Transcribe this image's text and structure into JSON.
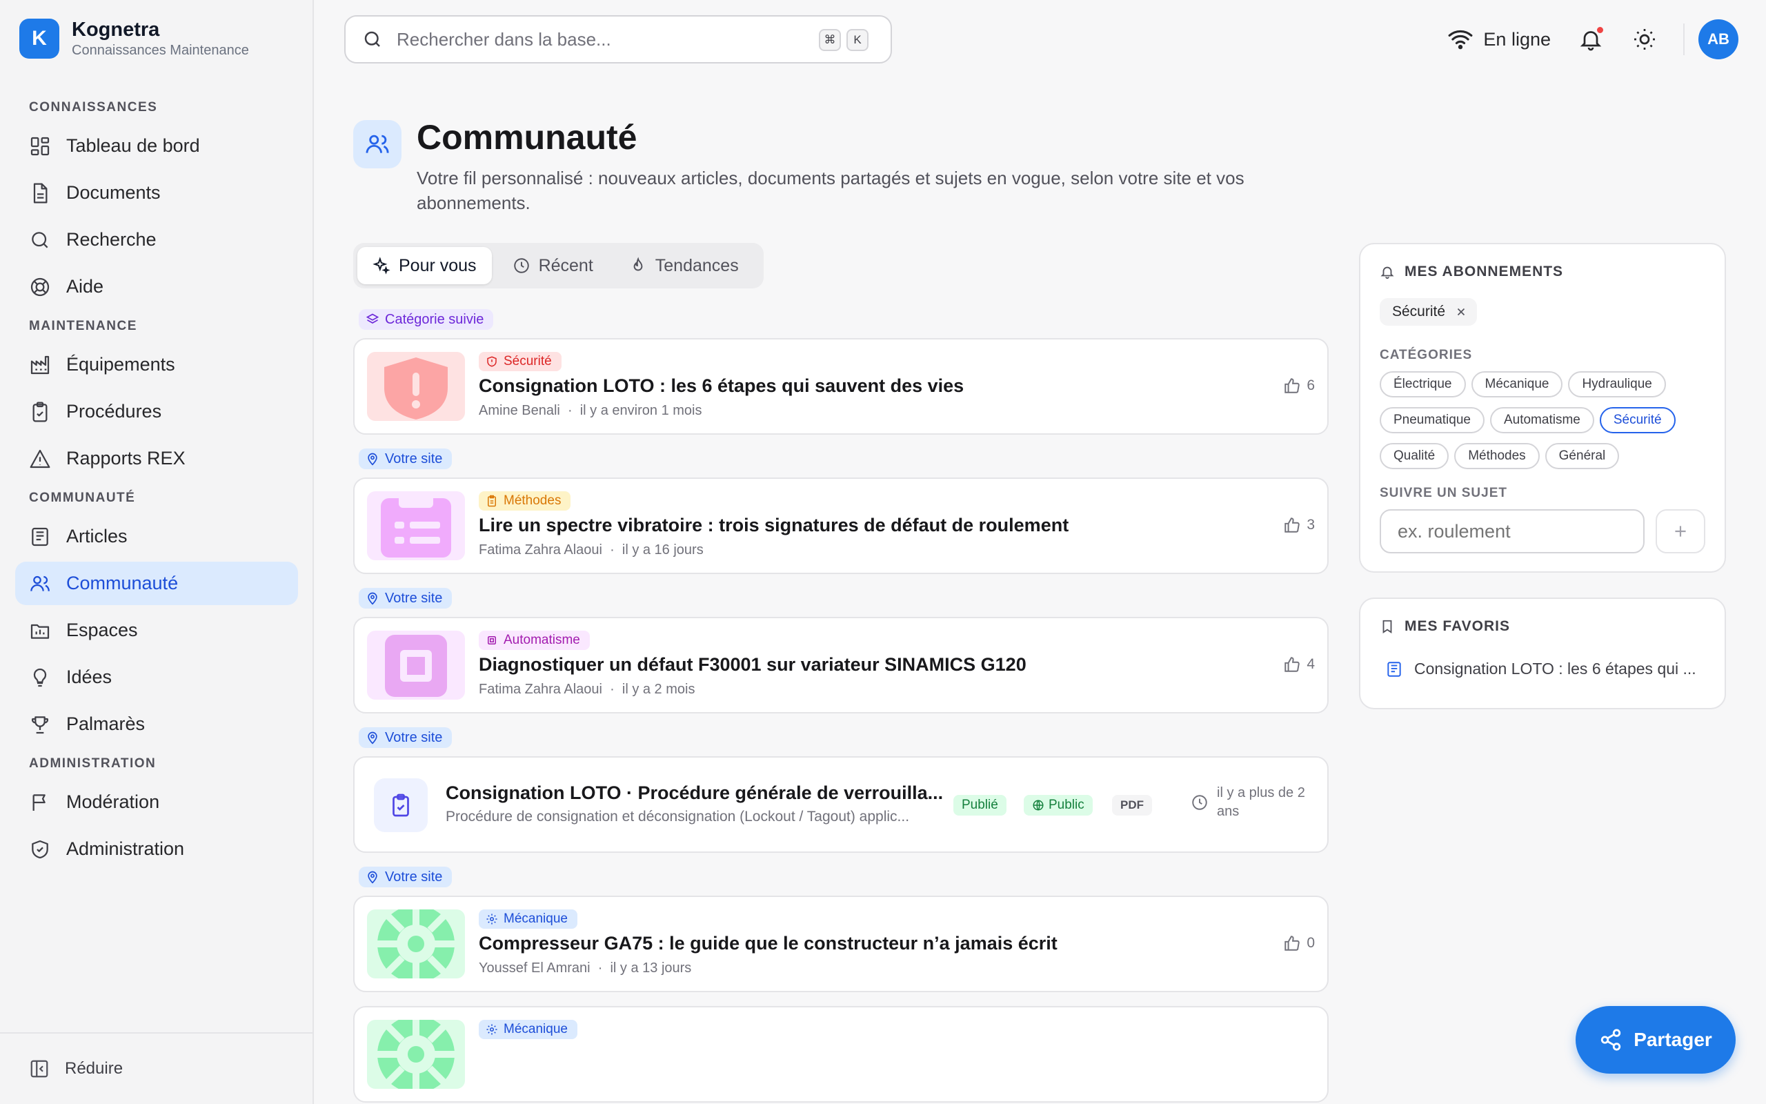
{
  "brand": {
    "name": "Kognetra",
    "subtitle": "Connaissances Maintenance",
    "logo_letter": "K"
  },
  "sidebar": {
    "sections": [
      {
        "title": "CONNAISSANCES",
        "items": [
          {
            "label": "Tableau de bord",
            "icon": "dashboard-icon"
          },
          {
            "label": "Documents",
            "icon": "document-icon"
          },
          {
            "label": "Recherche",
            "icon": "search-icon"
          },
          {
            "label": "Aide",
            "icon": "lifebuoy-icon"
          }
        ]
      },
      {
        "title": "MAINTENANCE",
        "items": [
          {
            "label": "Équipements",
            "icon": "factory-icon"
          },
          {
            "label": "Procédures",
            "icon": "clipboard-icon"
          },
          {
            "label": "Rapports REX",
            "icon": "warning-icon"
          }
        ]
      },
      {
        "title": "COMMUNAUTÉ",
        "items": [
          {
            "label": "Articles",
            "icon": "newspaper-icon"
          },
          {
            "label": "Communauté",
            "icon": "users-icon",
            "active": true
          },
          {
            "label": "Espaces",
            "icon": "folder-icon"
          },
          {
            "label": "Idées",
            "icon": "lightbulb-icon"
          },
          {
            "label": "Palmarès",
            "icon": "trophy-icon"
          }
        ]
      },
      {
        "title": "ADMINISTRATION",
        "items": [
          {
            "label": "Modération",
            "icon": "flag-icon"
          },
          {
            "label": "Administration",
            "icon": "shield-icon"
          }
        ]
      }
    ],
    "collapse_label": "Réduire"
  },
  "topbar": {
    "search_placeholder": "Rechercher dans la base...",
    "shortcut_keys": [
      "⌘",
      "K"
    ],
    "status": "En ligne",
    "avatar_initials": "AB"
  },
  "page": {
    "title": "Communauté",
    "description": "Votre fil personnalisé : nouveaux articles, documents partagés et sujets en vogue, selon votre site et vos abonnements."
  },
  "tabs": [
    {
      "label": "Pour vous",
      "active": true
    },
    {
      "label": "Récent"
    },
    {
      "label": "Tendances"
    }
  ],
  "feed": {
    "tag_category": "Catégorie suivie",
    "tag_site": "Votre site",
    "items": [
      {
        "type": "article",
        "reason": "cat",
        "category": "Sécurité",
        "title": "Consignation LOTO : les 6 étapes qui sauvent des vies",
        "author": "Amine Benali",
        "time": "il y a environ 1 mois",
        "likes": "6",
        "color": "#ef4444"
      },
      {
        "type": "article",
        "reason": "site",
        "category": "Méthodes",
        "title": "Lire un spectre vibratoire : trois signatures de défaut de roulement",
        "author": "Fatima Zahra Alaoui",
        "time": "il y a 16 jours",
        "likes": "3",
        "color": "#d946ef"
      },
      {
        "type": "article",
        "reason": "site",
        "category": "Automatisme",
        "title": "Diagnostiquer un défaut F30001 sur variateur SINAMICS G120",
        "author": "Fatima Zahra Alaoui",
        "time": "il y a 2 mois",
        "likes": "4",
        "color": "#c026d3"
      },
      {
        "type": "document",
        "reason": "site",
        "title": "Consignation LOTO · Procédure générale de verrouilla...",
        "subtitle": "Procédure de consignation et déconsignation (Lockout / Tagout) applic...",
        "status": "Publié",
        "visibility": "Public",
        "format": "PDF",
        "time": "il y a plus de 2 ans"
      },
      {
        "type": "article",
        "reason": "site",
        "category": "Mécanique",
        "title": "Compresseur GA75 : le guide que le constructeur n’a jamais écrit",
        "author": "Youssef El Amrani",
        "time": "il y a 13 jours",
        "likes": "0",
        "color": "#22c55e"
      },
      {
        "type": "article",
        "reason": "none",
        "category": "Mécanique",
        "title": "",
        "author": "",
        "time": "",
        "likes": "",
        "color": "#22c55e"
      }
    ]
  },
  "subscriptions": {
    "title": "MES ABONNEMENTS",
    "active": [
      "Sécurité"
    ],
    "categories_title": "CATÉGORIES",
    "categories": [
      "Électrique",
      "Mécanique",
      "Hydraulique",
      "Pneumatique",
      "Automatisme",
      "Sécurité",
      "Qualité",
      "Méthodes",
      "Général"
    ],
    "selected_category": "Sécurité",
    "follow_title": "SUIVRE UN SUJET",
    "follow_placeholder": "ex. roulement"
  },
  "favorites": {
    "title": "MES FAVORIS",
    "items": [
      "Consignation LOTO : les 6 étapes qui ..."
    ]
  },
  "share_label": "Partager"
}
